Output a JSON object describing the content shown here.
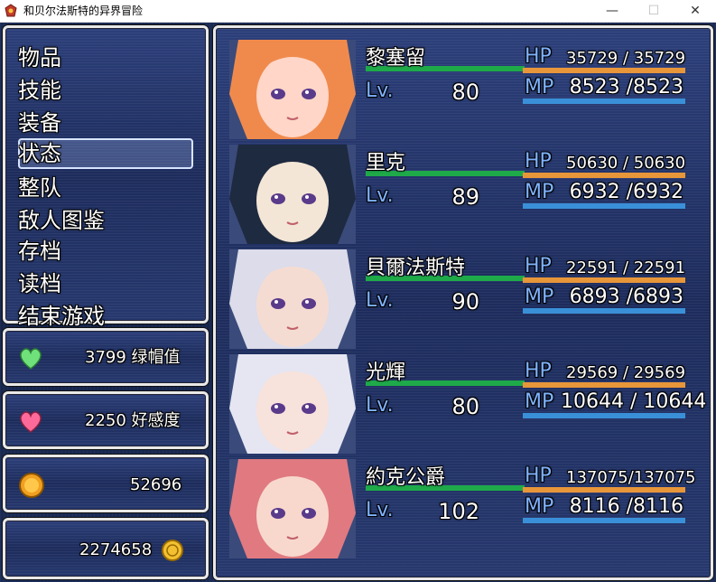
{
  "window": {
    "title": "和贝尔法斯特的异界冒险",
    "controls": [
      "—",
      "☐",
      "✕"
    ]
  },
  "menu": {
    "items": [
      "物品",
      "技能",
      "装备",
      "状态",
      "整队",
      "敌人图鉴",
      "存档",
      "读档",
      "结束游戏"
    ],
    "selected_index": 3
  },
  "stats": [
    {
      "icon": "green-heart-icon",
      "value": "3799 绿帽值"
    },
    {
      "icon": "pink-heart-icon",
      "value": "2250 好感度"
    },
    {
      "icon": "gold-coin-icon",
      "value": "52696"
    },
    {
      "icon": "gold-medal-icon",
      "value": "2274658"
    }
  ],
  "labels": {
    "lv": "Lv.",
    "hp": "HP",
    "mp": "MP"
  },
  "colors": {
    "name_gauge": "#1faa4a",
    "hp_gauge": "#e8963a",
    "mp_gauge": "#3a90d8",
    "label_blue": "#7fb3ff"
  },
  "party": [
    {
      "name": "黎塞留",
      "level": "80",
      "hp": "35729 / 35729",
      "mp": "8523 /8523",
      "hair": "#f08a4c",
      "skin": "#ffd6c8"
    },
    {
      "name": "里克",
      "level": "89",
      "hp": "50630 / 50630",
      "mp": "6932 /6932",
      "hair": "#1e2a40",
      "skin": "#f3e6d6"
    },
    {
      "name": "貝爾法斯特",
      "level": "90",
      "hp": "22591 / 22591",
      "mp": "6893 /6893",
      "hair": "#dcdcea",
      "skin": "#f5dcd2"
    },
    {
      "name": "光輝",
      "level": "80",
      "hp": "29569 / 29569",
      "mp": "10644 / 10644",
      "hair": "#e6e6f2",
      "skin": "#f7e2dc"
    },
    {
      "name": "約克公爵",
      "level": "102",
      "hp": "137075/137075",
      "mp": "8116 /8116",
      "hair": "#e07a80",
      "skin": "#f8d8cc"
    }
  ]
}
